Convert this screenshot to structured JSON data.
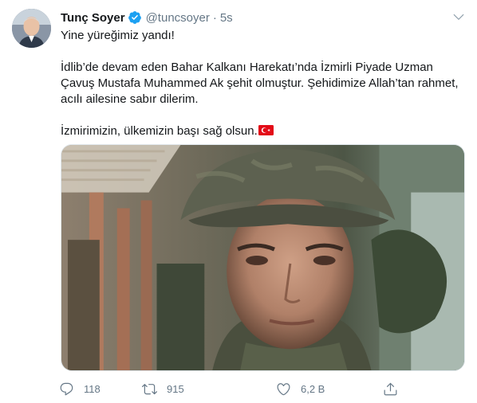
{
  "tweet": {
    "author_name": "Tunç Soyer",
    "handle": "@tuncsoyer",
    "separator": "·",
    "time": "5s",
    "verified": true,
    "lines": [
      "Yine yüreğimiz yandı!",
      "İdlib’de devam eden Bahar Kalkanı Harekatı’nda İzmirli Piyade Uzman Çavuş Mustafa Muhammed Ak şehit olmuştur. Şehidimize Allah’tan rahmet, acılı ailesine sabır dilerim.",
      "İzmirimizin, ülkemizin başı sağ olsun."
    ],
    "flag_emoji": "turkey-flag"
  },
  "actions": {
    "reply_count": "118",
    "retweet_count": "915",
    "like_count": "6,2 B"
  },
  "colors": {
    "text": "#14171a",
    "secondary": "#657786",
    "verified": "#1da1f2",
    "flag_red": "#e30a17"
  },
  "icons": [
    "caret-down-icon",
    "verified-badge-icon",
    "reply-icon",
    "retweet-icon",
    "like-icon",
    "share-icon",
    "turkey-flag-icon"
  ]
}
